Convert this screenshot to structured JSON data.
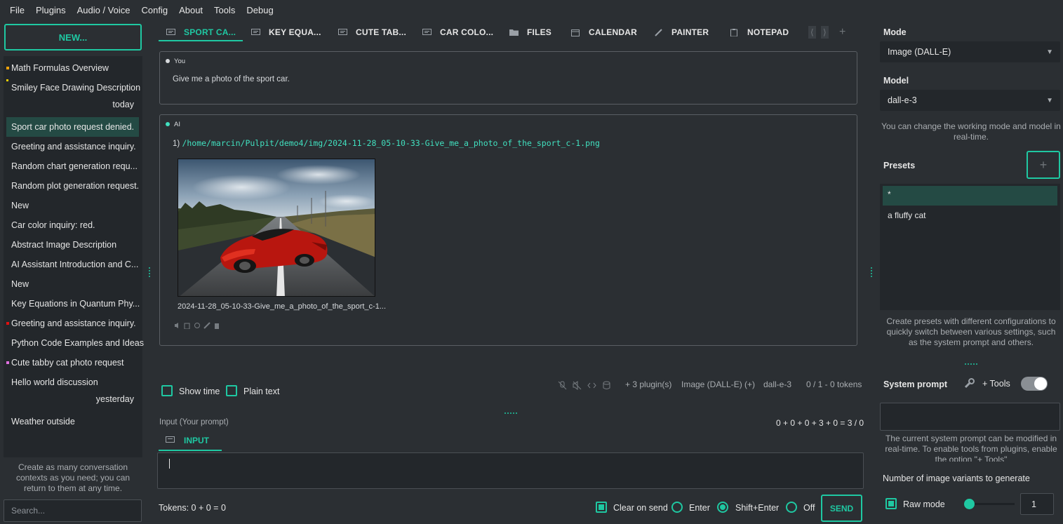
{
  "menu": [
    "File",
    "Plugins",
    "Audio / Voice",
    "Config",
    "About",
    "Tools",
    "Debug"
  ],
  "left": {
    "new_label": "NEW...",
    "contexts": [
      {
        "label": "Math Formulas Overview",
        "marker": "#f0a30a"
      },
      {
        "label": "Smiley Face Drawing Description",
        "marker": "#f0d000"
      },
      {
        "label": "Sport car photo request denied.",
        "selected": true
      },
      {
        "label": "Greeting and assistance inquiry."
      },
      {
        "label": "Random chart generation requ..."
      },
      {
        "label": "Random plot generation request."
      },
      {
        "label": "New"
      },
      {
        "label": "Car color inquiry: red."
      },
      {
        "label": "Abstract Image Description"
      },
      {
        "label": "AI Assistant Introduction and C..."
      },
      {
        "label": "New"
      },
      {
        "label": "Key Equations in Quantum Phy..."
      },
      {
        "label": "Greeting and assistance inquiry.",
        "marker": "#e01010"
      },
      {
        "label": "Python Code Examples and Ideas"
      },
      {
        "label": "Cute tabby cat photo request",
        "marker": "#e070e0"
      },
      {
        "label": "Hello world discussion"
      },
      {
        "label": "Weather outside"
      }
    ],
    "date_today": "today",
    "date_yesterday": "yesterday",
    "hint": "Create as many conversation contexts as you need; you can return to them at any time.",
    "search_placeholder": "Search..."
  },
  "tabs": [
    {
      "label": "SPORT CA...",
      "icon": "chat-icon"
    },
    {
      "label": "KEY EQUA...",
      "icon": "chat-icon"
    },
    {
      "label": "CUTE TAB...",
      "icon": "chat-icon"
    },
    {
      "label": "CAR COLO...",
      "icon": "chat-icon"
    },
    {
      "label": "FILES",
      "icon": "folder-icon"
    },
    {
      "label": "CALENDAR",
      "icon": "calendar-icon"
    },
    {
      "label": "PAINTER",
      "icon": "brush-icon"
    },
    {
      "label": "NOTEPAD",
      "icon": "clipboard-icon"
    }
  ],
  "chat": {
    "user_name": "You",
    "user_text": "Give me a photo of the sport car.",
    "ai_name": "AI",
    "ai_index": "1)",
    "ai_link": "/home/marcin/Pulpit/demo4/img/2024-11-28_05-10-33-Give_me_a_photo_of_the_sport_c-1.png",
    "image_caption": "2024-11-28_05-10-33-Give_me_a_photo_of_the_sport_c-1..."
  },
  "status": {
    "show_time": "Show time",
    "plain_text": "Plain text",
    "plugins": "+ 3 plugin(s)",
    "mode": "Image (DALL-E) (+)",
    "model": "dall-e-3",
    "tokens": "0 / 1 - 0 tokens"
  },
  "input": {
    "label": "Input (Your prompt)",
    "count": "0 + 0 + 0 + 3 + 0 = 3 / 0",
    "tab_label": "INPUT",
    "tokens": "Tokens: 0 + 0 = 0",
    "clear_on_send": "Clear on send",
    "enter": "Enter",
    "shift_enter": "Shift+Enter",
    "off": "Off",
    "send": "SEND"
  },
  "right": {
    "mode_title": "Mode",
    "mode_value": "Image (DALL-E)",
    "model_title": "Model",
    "model_value": "dall-e-3",
    "mode_hint": "You can change the working mode and model in real-time.",
    "presets_title": "Presets",
    "presets": [
      "*",
      "a fluffy cat"
    ],
    "presets_hint": "Create presets with different configurations to quickly switch between various settings, such as the system prompt and others.",
    "system_prompt": "System prompt",
    "tools_label": "+ Tools",
    "system_hint": "The current system prompt can be modified in real-time. To enable tools from plugins, enable the option \"+ Tools\"",
    "variants_label": "Number of image variants to generate",
    "raw_mode": "Raw mode",
    "variants_value": "1"
  },
  "colors": {
    "accent": "#1fc8a2",
    "bg": "#2b2f33",
    "panel": "#23272b"
  }
}
